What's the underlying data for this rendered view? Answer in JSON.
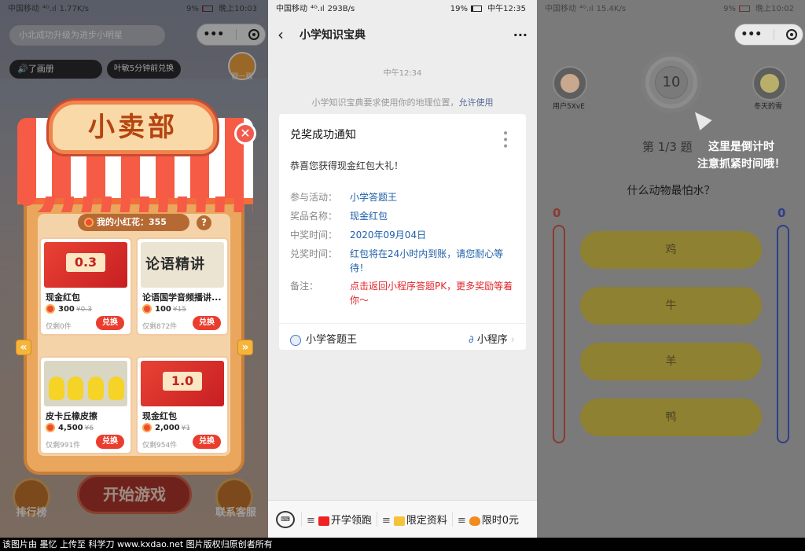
{
  "panel1": {
    "status": {
      "carrier": "中国移动",
      "net": "⁴ᴳ.ıl",
      "speed": "1.77K/s",
      "battery": "9%",
      "time": "晚上10:03"
    },
    "search_placeholder": "小北成功升级为进步小明星",
    "audio_label": "了画册",
    "ticker_text": "叶敏5分钟前兑换",
    "coin_text": "355",
    "corner_label": "戳一戳",
    "shop_title": "小卖部",
    "balance_label": "我的小红花：355",
    "help_label": "?",
    "close_label": "✕",
    "prev_label": "«",
    "next_label": "»",
    "products": [
      {
        "image_text": "0.3",
        "name": "现金红包",
        "price": "300",
        "original": "¥0.3",
        "remaining": "仅剩0件",
        "button": "兑换"
      },
      {
        "image_text": "论语精讲",
        "name": "论语国学音频播讲...",
        "price": "100",
        "original": "¥15",
        "remaining": "仅剩872件",
        "button": "兑换"
      },
      {
        "image_text": "",
        "name": "皮卡丘橡皮擦",
        "price": "4,500",
        "original": "¥6",
        "remaining": "仅剩991件",
        "button": "兑换"
      },
      {
        "image_text": "1.0",
        "name": "现金红包",
        "price": "2,000",
        "original": "¥1",
        "remaining": "仅剩954件",
        "button": "兑换"
      }
    ],
    "start_button": "开始游戏",
    "rank_label": "排行榜",
    "service_label": "联系客服"
  },
  "panel2": {
    "status": {
      "carrier": "中国移动",
      "net": "⁴ᴳ.ıl",
      "speed": "293B/s",
      "battery": "19%",
      "time": "中午12:35"
    },
    "nav_title": "小学知识宝典",
    "message_time": "中午12:34",
    "location_notice": "小学知识宝典要求使用你的地理位置，",
    "location_allow": "允许使用",
    "card": {
      "title": "兑奖成功通知",
      "greeting": "恭喜您获得现金红包大礼！",
      "rows": [
        {
          "key": "参与活动：",
          "value": "小学答题王"
        },
        {
          "key": "奖品名称：",
          "value": "现金红包"
        },
        {
          "key": "中奖时间：",
          "value": "2020年09月04日"
        },
        {
          "key": "兑奖时间：",
          "value": "红包将在24小时内到账，请您耐心等待！"
        },
        {
          "key": "备注：",
          "value": "点击返回小程序答题PK，更多奖励等着你～"
        }
      ],
      "footer_app": "小学答题王",
      "footer_link": "小程序"
    },
    "bottom_menu": [
      "开学领跑",
      "限定资料",
      "限时0元"
    ]
  },
  "panel3": {
    "status": {
      "carrier": "中国移动",
      "net": "⁴ᴳ.ıl",
      "speed": "15.4K/s",
      "battery": "9%",
      "time": "晚上10:02"
    },
    "user_left": "用户5XvE",
    "user_right": "冬天的雪",
    "countdown": "10",
    "question_number": "第 1/3 题",
    "hint_line1": "这里是倒计时",
    "hint_line2": "注意抓紧时间哦！",
    "question": "什么动物最怕水？",
    "score_left": "0",
    "score_right": "0",
    "options": [
      "鸡",
      "牛",
      "羊",
      "鸭"
    ]
  },
  "credit_text": "该图片由 墨忆 上传至 科学刀 www.kxdao.net 图片版权归原创者所有",
  "colors": {
    "shop_red": "#f55b45",
    "link_blue": "#1e5fa8",
    "alert_red": "#e3262a",
    "score_red": "#c0392b",
    "score_blue": "#2f3fa8"
  }
}
